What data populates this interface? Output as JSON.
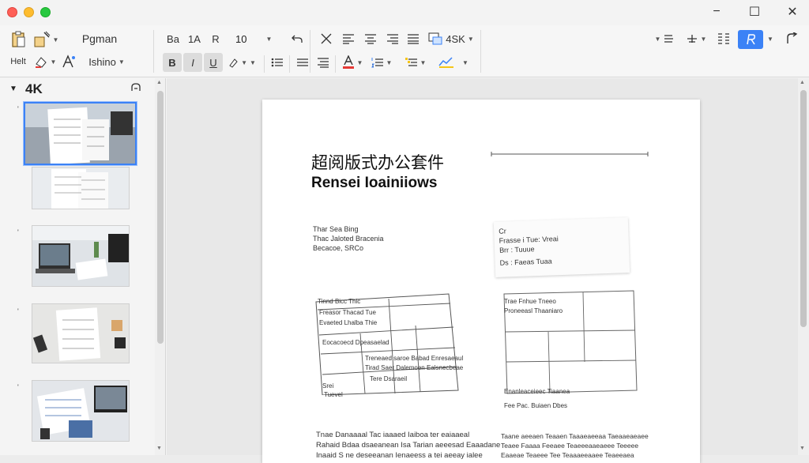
{
  "window": {
    "controls": {
      "minimize": "−",
      "maximize": "☐",
      "close": "✕"
    }
  },
  "ribbon": {
    "row1": {
      "style_name": "Pgman",
      "font_a": "Ba",
      "font_b": "1A",
      "font_c": "R",
      "font_size": "10",
      "zoom_label": "4SK"
    },
    "row2": {
      "left_label": "Helt",
      "style_picker": "Ishino",
      "bold": "B",
      "italic": "I",
      "underline": "U"
    }
  },
  "panel": {
    "title": "4K",
    "thumbs": [
      {
        "number": "'"
      },
      {
        "number": ""
      },
      {
        "number": "'"
      },
      {
        "number": "'"
      },
      {
        "number": "'"
      }
    ]
  },
  "document": {
    "title_cn": "超阅版式办公套件",
    "title_en": "Rensei Ioainiiows",
    "left_block": {
      "line1": "Thar Sea Bing",
      "line2": "Thac Jaloted Bracenia",
      "line3": "Becacoe, SRCo"
    },
    "right_block": {
      "line1": "Cr",
      "line2": "Frasse i Tue: Vreai",
      "line3": "Brr :   Tuuue",
      "line4": "Ds :  Faeas Tuaa"
    },
    "table_left": {
      "header": "Tinnd Bicc Thic",
      "row1": "Freasor Thacad Tue",
      "row2": "Evaeted Lhalba Thie",
      "row3": "Eocacoecd  Dpeasaelad",
      "row4": "Treneaed saroe Babad   Enresaeaul",
      "row5": "Tirad Saer Dalemoen   Ealsnecbeae",
      "row6": "Tere Dsaraeil",
      "row7": "Srei",
      "row8": "Tuevel"
    },
    "table_right": {
      "header": "Trae Fnhue Tneeo",
      "row1": "Proneeasl Thaaniaro",
      "row2": "Enanleaceieec Tiaanea",
      "caption": "Fee Pac.  Buiaen Dbes"
    },
    "para_left": {
      "line1": "Tnae Danaaaal  Tac iaaaed  Iaiboa  ter eaiaaeal",
      "line2": "Rahaid Bdaa dsaeanean Isa Tarian aeeesad Eaaadane",
      "line3": "Inaaid  S ne deseeanan  Ienaeess a tei aeeay ialee"
    },
    "para_right": {
      "line1": "Taane aeeaen   Teaaen  Taaaeaeeaa  Taeaaeaeaee",
      "line2": "Teaee  Faaaa  Feeaee Teaeeeaaeaeee Teeeee",
      "line3": "Eaaeae  Teaeee  Tee Teaaaeeaaee Teaeeaea"
    }
  },
  "colors": {
    "accent": "#3b82f6",
    "font_color_bar": "#e53935",
    "highlight_bar": "#f5c518"
  }
}
